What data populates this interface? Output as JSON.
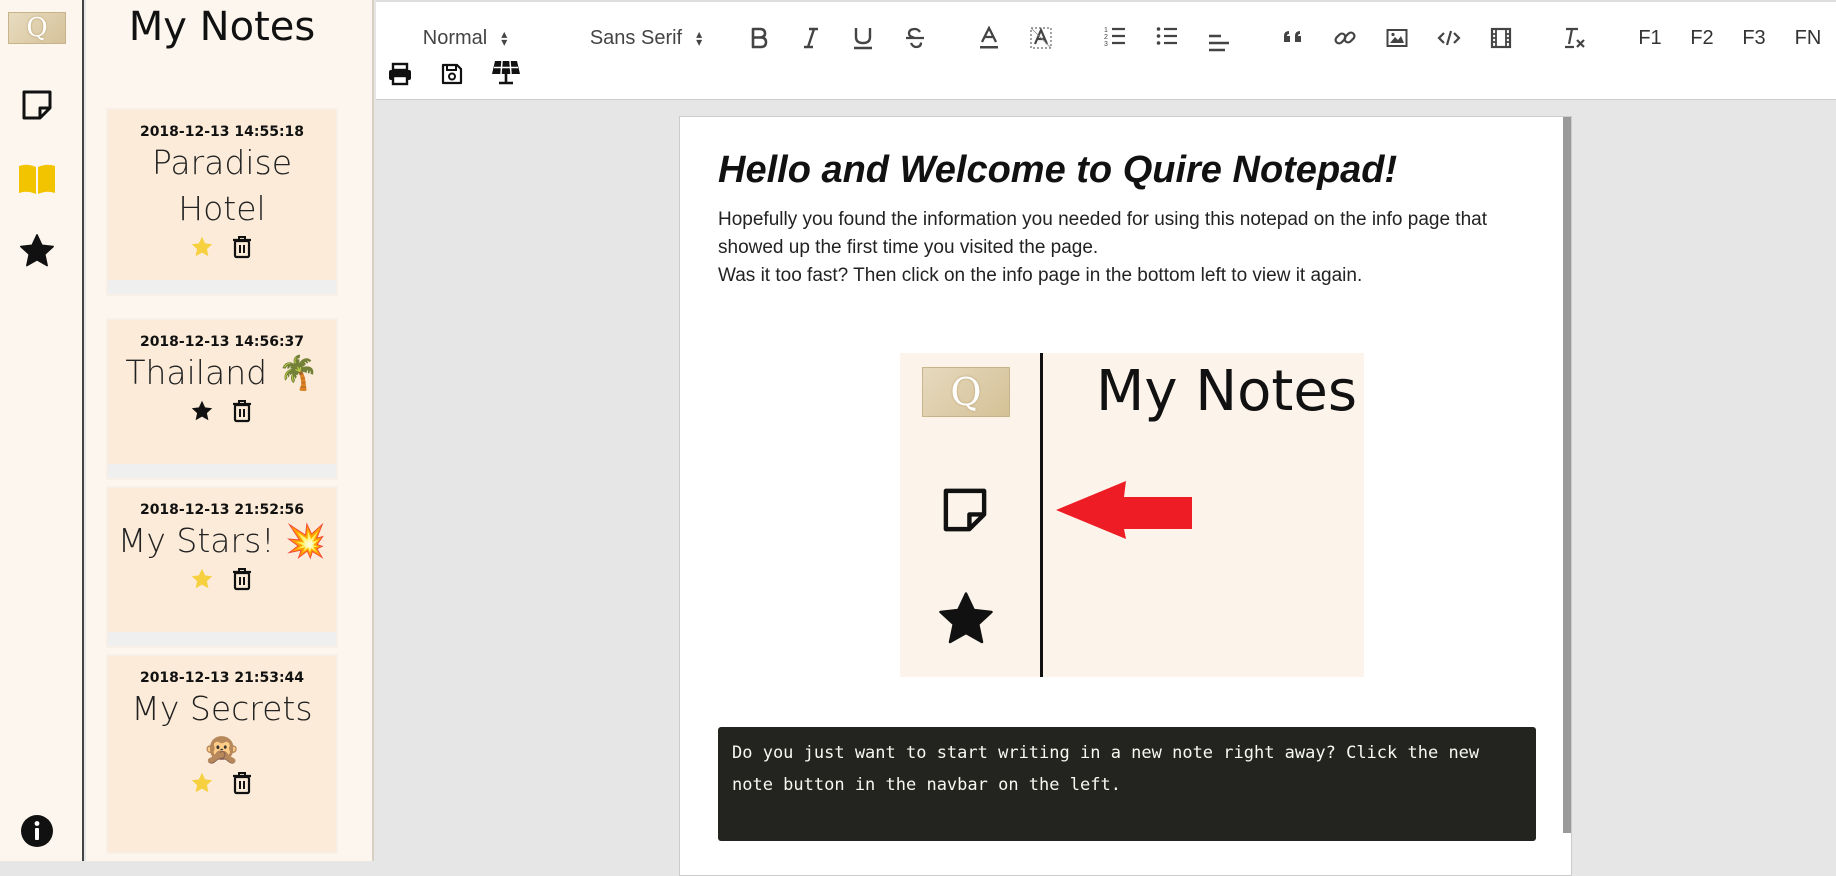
{
  "app": {
    "name": "Quire Notepad",
    "logo_letter": "Q"
  },
  "navbar": {
    "items": [
      {
        "icon": "new-note-icon"
      },
      {
        "icon": "book-icon",
        "color": "#f2c400"
      },
      {
        "icon": "star-icon"
      },
      {
        "icon": "info-icon"
      }
    ]
  },
  "notes_panel": {
    "title": "My Notes",
    "notes": [
      {
        "date": "2018-12-13 14:55:18",
        "title": "Paradise Hotel",
        "emoji": "",
        "starred": true
      },
      {
        "date": "2018-12-13 14:56:37",
        "title": "Thailand",
        "emoji": "🌴",
        "starred": false
      },
      {
        "date": "2018-12-13 21:52:56",
        "title": "My Stars!",
        "emoji": "💥",
        "starred": true
      },
      {
        "date": "2018-12-13 21:53:44",
        "title": "My Secrets",
        "emoji": "🙊",
        "starred": true
      }
    ],
    "star_color_active": "#f7d040"
  },
  "toolbar": {
    "header_select": "Normal",
    "font_select": "Sans Serif",
    "buttons": [
      "bold-icon",
      "italic-icon",
      "underline-icon",
      "strike-icon",
      "text-color-icon",
      "background-color-icon",
      "ordered-list-icon",
      "bullet-list-icon",
      "align-icon",
      "blockquote-icon",
      "link-icon",
      "image-icon",
      "code-icon",
      "video-icon",
      "clear-format-icon"
    ],
    "function_keys": [
      "F1",
      "F2",
      "F3",
      "FN"
    ],
    "row2": [
      "print-icon",
      "save-icon",
      "solar-panel-icon"
    ]
  },
  "document": {
    "heading": "Hello and Welcome to Quire Notepad!",
    "paragraph_lines": [
      "Hopefully you found the information you needed for using this notepad on the info page that",
      "showed up the first time you visited the page.",
      "Was it too fast? Then click on the info page in the bottom left to view it again."
    ],
    "figure": {
      "title": "My Notes",
      "logo_letter": "Q",
      "arrow_color": "#ee1c24"
    },
    "code_block": "Do you just want to start writing in a new note right away? Click the new\nnote button in the navbar on the left."
  }
}
